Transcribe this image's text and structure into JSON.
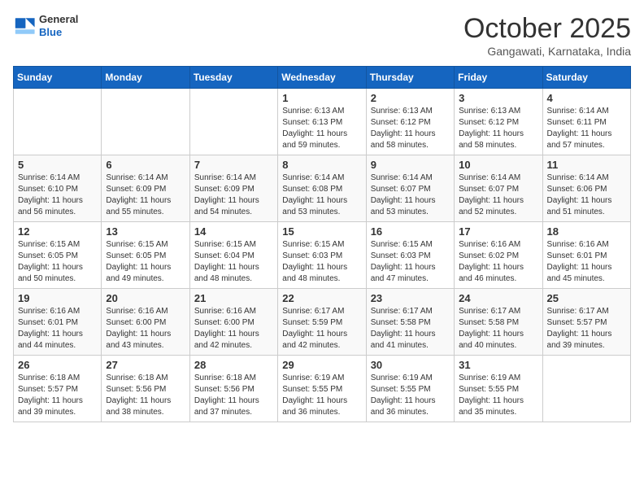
{
  "header": {
    "logo_general": "General",
    "logo_blue": "Blue",
    "month_title": "October 2025",
    "subtitle": "Gangawati, Karnataka, India"
  },
  "calendar": {
    "days_of_week": [
      "Sunday",
      "Monday",
      "Tuesday",
      "Wednesday",
      "Thursday",
      "Friday",
      "Saturday"
    ],
    "weeks": [
      [
        {
          "day": "",
          "info": ""
        },
        {
          "day": "",
          "info": ""
        },
        {
          "day": "",
          "info": ""
        },
        {
          "day": "1",
          "info": "Sunrise: 6:13 AM\nSunset: 6:13 PM\nDaylight: 11 hours\nand 59 minutes."
        },
        {
          "day": "2",
          "info": "Sunrise: 6:13 AM\nSunset: 6:12 PM\nDaylight: 11 hours\nand 58 minutes."
        },
        {
          "day": "3",
          "info": "Sunrise: 6:13 AM\nSunset: 6:12 PM\nDaylight: 11 hours\nand 58 minutes."
        },
        {
          "day": "4",
          "info": "Sunrise: 6:14 AM\nSunset: 6:11 PM\nDaylight: 11 hours\nand 57 minutes."
        }
      ],
      [
        {
          "day": "5",
          "info": "Sunrise: 6:14 AM\nSunset: 6:10 PM\nDaylight: 11 hours\nand 56 minutes."
        },
        {
          "day": "6",
          "info": "Sunrise: 6:14 AM\nSunset: 6:09 PM\nDaylight: 11 hours\nand 55 minutes."
        },
        {
          "day": "7",
          "info": "Sunrise: 6:14 AM\nSunset: 6:09 PM\nDaylight: 11 hours\nand 54 minutes."
        },
        {
          "day": "8",
          "info": "Sunrise: 6:14 AM\nSunset: 6:08 PM\nDaylight: 11 hours\nand 53 minutes."
        },
        {
          "day": "9",
          "info": "Sunrise: 6:14 AM\nSunset: 6:07 PM\nDaylight: 11 hours\nand 53 minutes."
        },
        {
          "day": "10",
          "info": "Sunrise: 6:14 AM\nSunset: 6:07 PM\nDaylight: 11 hours\nand 52 minutes."
        },
        {
          "day": "11",
          "info": "Sunrise: 6:14 AM\nSunset: 6:06 PM\nDaylight: 11 hours\nand 51 minutes."
        }
      ],
      [
        {
          "day": "12",
          "info": "Sunrise: 6:15 AM\nSunset: 6:05 PM\nDaylight: 11 hours\nand 50 minutes."
        },
        {
          "day": "13",
          "info": "Sunrise: 6:15 AM\nSunset: 6:05 PM\nDaylight: 11 hours\nand 49 minutes."
        },
        {
          "day": "14",
          "info": "Sunrise: 6:15 AM\nSunset: 6:04 PM\nDaylight: 11 hours\nand 48 minutes."
        },
        {
          "day": "15",
          "info": "Sunrise: 6:15 AM\nSunset: 6:03 PM\nDaylight: 11 hours\nand 48 minutes."
        },
        {
          "day": "16",
          "info": "Sunrise: 6:15 AM\nSunset: 6:03 PM\nDaylight: 11 hours\nand 47 minutes."
        },
        {
          "day": "17",
          "info": "Sunrise: 6:16 AM\nSunset: 6:02 PM\nDaylight: 11 hours\nand 46 minutes."
        },
        {
          "day": "18",
          "info": "Sunrise: 6:16 AM\nSunset: 6:01 PM\nDaylight: 11 hours\nand 45 minutes."
        }
      ],
      [
        {
          "day": "19",
          "info": "Sunrise: 6:16 AM\nSunset: 6:01 PM\nDaylight: 11 hours\nand 44 minutes."
        },
        {
          "day": "20",
          "info": "Sunrise: 6:16 AM\nSunset: 6:00 PM\nDaylight: 11 hours\nand 43 minutes."
        },
        {
          "day": "21",
          "info": "Sunrise: 6:16 AM\nSunset: 6:00 PM\nDaylight: 11 hours\nand 42 minutes."
        },
        {
          "day": "22",
          "info": "Sunrise: 6:17 AM\nSunset: 5:59 PM\nDaylight: 11 hours\nand 42 minutes."
        },
        {
          "day": "23",
          "info": "Sunrise: 6:17 AM\nSunset: 5:58 PM\nDaylight: 11 hours\nand 41 minutes."
        },
        {
          "day": "24",
          "info": "Sunrise: 6:17 AM\nSunset: 5:58 PM\nDaylight: 11 hours\nand 40 minutes."
        },
        {
          "day": "25",
          "info": "Sunrise: 6:17 AM\nSunset: 5:57 PM\nDaylight: 11 hours\nand 39 minutes."
        }
      ],
      [
        {
          "day": "26",
          "info": "Sunrise: 6:18 AM\nSunset: 5:57 PM\nDaylight: 11 hours\nand 39 minutes."
        },
        {
          "day": "27",
          "info": "Sunrise: 6:18 AM\nSunset: 5:56 PM\nDaylight: 11 hours\nand 38 minutes."
        },
        {
          "day": "28",
          "info": "Sunrise: 6:18 AM\nSunset: 5:56 PM\nDaylight: 11 hours\nand 37 minutes."
        },
        {
          "day": "29",
          "info": "Sunrise: 6:19 AM\nSunset: 5:55 PM\nDaylight: 11 hours\nand 36 minutes."
        },
        {
          "day": "30",
          "info": "Sunrise: 6:19 AM\nSunset: 5:55 PM\nDaylight: 11 hours\nand 36 minutes."
        },
        {
          "day": "31",
          "info": "Sunrise: 6:19 AM\nSunset: 5:55 PM\nDaylight: 11 hours\nand 35 minutes."
        },
        {
          "day": "",
          "info": ""
        }
      ]
    ]
  }
}
